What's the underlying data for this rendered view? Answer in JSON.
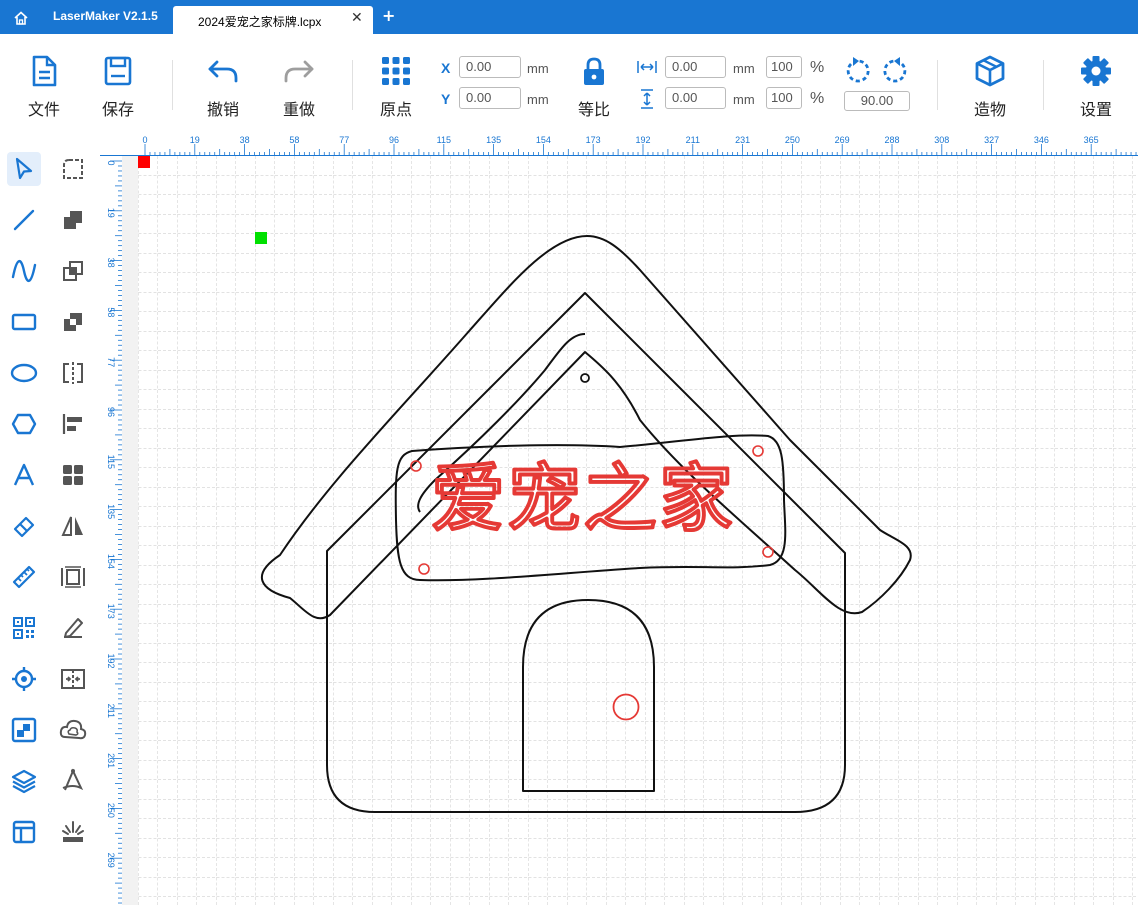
{
  "app": {
    "title": "LaserMaker V2.1.5",
    "tab_title": "2024爱宠之家标牌.lcpx",
    "tab_close": "✕",
    "add_tab": "+"
  },
  "toolbar": {
    "file": "文件",
    "save": "保存",
    "undo": "撤销",
    "redo": "重做",
    "origin": "原点",
    "x_label": "X",
    "y_label": "Y",
    "x_value": "0.00",
    "y_value": "0.00",
    "mm": "mm",
    "proportional": "等比",
    "width_value": "0.00",
    "height_value": "0.00",
    "width_percent": "100",
    "height_percent": "100",
    "percent": "%",
    "rotate_value": "90.00",
    "object": "造物",
    "settings": "设置"
  },
  "ruler": {
    "unit": "mm",
    "h_labels": [
      "0",
      "19",
      "38",
      "58",
      "77",
      "96",
      "115",
      "135",
      "154",
      "173",
      "192",
      "211",
      "231",
      "250",
      "269",
      "288",
      "308",
      "327",
      "346",
      "365"
    ],
    "v_labels": [
      "0",
      "19",
      "38",
      "58",
      "77",
      "96",
      "115",
      "135",
      "154",
      "173",
      "192",
      "211",
      "231",
      "250",
      "269"
    ]
  },
  "design": {
    "sign_text": "爱宠之家"
  },
  "colors": {
    "accent": "#1976d2",
    "red_marker": "#ff0000",
    "green_marker": "#00e000",
    "cut_red": "#e53935"
  }
}
